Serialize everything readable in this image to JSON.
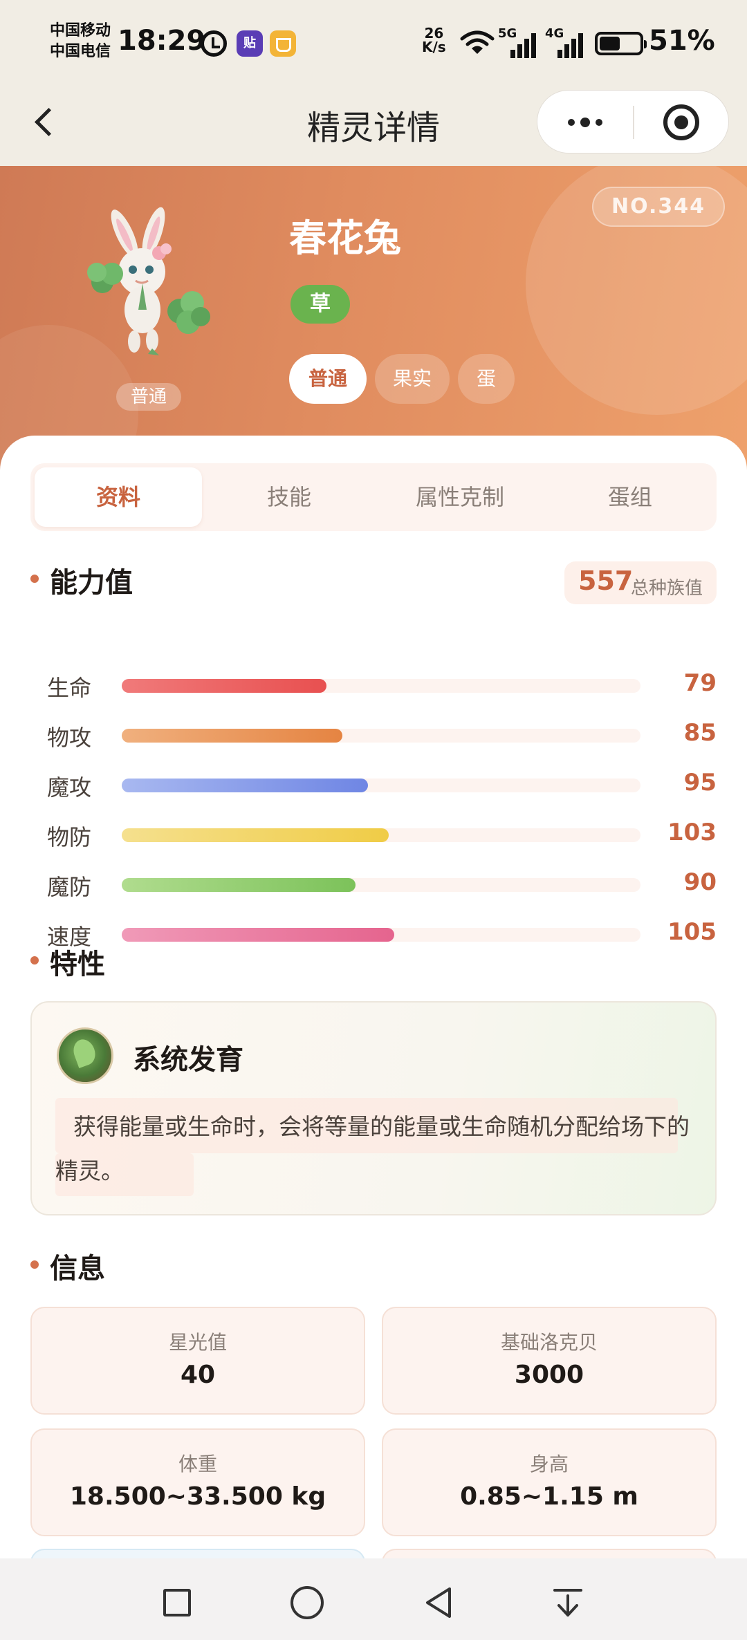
{
  "status_bar": {
    "carrier_1": "中国移动",
    "carrier_2": "中国电信",
    "time": "18:29",
    "app_badge": "贴",
    "net_speed_value": "26",
    "net_speed_unit": "K/s",
    "signal_1_tag": "5G",
    "signal_2_tag": "4G",
    "battery": "51%",
    "battery_level": 0.51
  },
  "nav": {
    "title": "精灵详情"
  },
  "hero": {
    "number": "NO.344",
    "name": "春花兔",
    "type": "草",
    "sprite_form_label": "普通",
    "forms": [
      "普通",
      "果实",
      "蛋"
    ],
    "active_form": "普通"
  },
  "tabs": [
    "资料",
    "技能",
    "属性克制",
    "蛋组"
  ],
  "active_tab": "资料",
  "stats": {
    "title": "能力值",
    "total": "557",
    "total_label": "总种族值",
    "items": [
      {
        "label": "生命",
        "value": 79,
        "fill": 0.395,
        "color_start": "#f07a7a",
        "color_end": "#e85050"
      },
      {
        "label": "物攻",
        "value": 85,
        "fill": 0.425,
        "color_start": "#f0b07e",
        "color_end": "#e58442"
      },
      {
        "label": "魔攻",
        "value": 95,
        "fill": 0.475,
        "color_start": "#a8b8f0",
        "color_end": "#6f86e4"
      },
      {
        "label": "物防",
        "value": 103,
        "fill": 0.515,
        "color_start": "#f5e08e",
        "color_end": "#f0cc46"
      },
      {
        "label": "魔防",
        "value": 90,
        "fill": 0.45,
        "color_start": "#b0dc8e",
        "color_end": "#7cc25a"
      },
      {
        "label": "速度",
        "value": 105,
        "fill": 0.525,
        "color_start": "#f09ab8",
        "color_end": "#e5648e"
      }
    ]
  },
  "trait": {
    "title": "特性",
    "name": "系统发育",
    "description": "获得能量或生命时，会将等量的能量或生命随机分配给场下的精灵。"
  },
  "info": {
    "title": "信息",
    "items": [
      {
        "label": "星光值",
        "value": "40"
      },
      {
        "label": "基础洛克贝",
        "value": "3000"
      },
      {
        "label": "体重",
        "value": "18.500~33.500 kg"
      },
      {
        "label": "身高",
        "value": "0.85~1.15 m"
      }
    ]
  },
  "colors": {
    "accent": "#c8633f",
    "hero_start": "#cf7a55",
    "hero_end": "#eea16c",
    "type_grass": "#6ab34e"
  }
}
